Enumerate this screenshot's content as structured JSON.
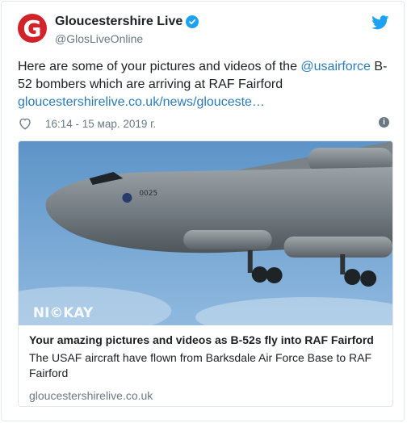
{
  "author": {
    "avatar_letter": "G",
    "display_name": "Gloucestershire Live",
    "handle": "@GlosLiveOnline",
    "brand_color": "#d2232a"
  },
  "tweet": {
    "text_before_mention": "Here are some of your pictures and videos of the ",
    "mention": "@usairforce",
    "text_after_mention": " B-52 bombers which are arriving at RAF Fairford",
    "link": "gloucestershirelive.co.uk/news/glouceste…",
    "timestamp": "16:14 - 15 мар. 2019 г."
  },
  "card": {
    "image_alt": "B-52 bomber aircraft in flight",
    "image_watermark": "NI©KAY",
    "aircraft_tail_number": "0025",
    "title": "Your amazing pictures and videos as B-52s fly into RAF Fairford",
    "description": "The USAF aircraft have flown from Barksdale Air Force Base to RAF Fairford",
    "domain": "gloucestershirelive.co.uk"
  },
  "icons": {
    "verified": "verified-badge-icon",
    "twitter": "twitter-bird-icon",
    "like": "heart-icon",
    "info": "info-icon"
  },
  "colors": {
    "link": "#2b7bb9",
    "twitter_blue": "#1da1f2",
    "muted": "#697882"
  }
}
